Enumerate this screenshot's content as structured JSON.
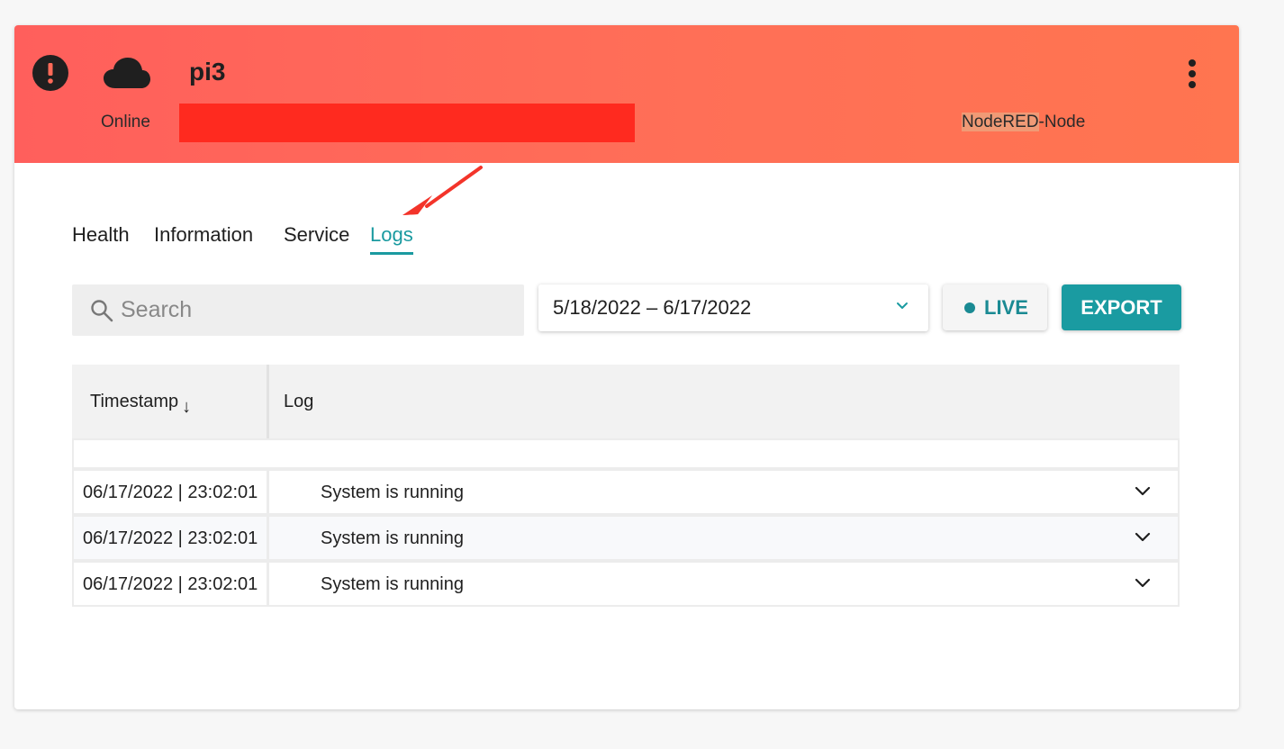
{
  "header": {
    "device_name": "pi3",
    "status": "Online",
    "node_type_highlight": "NodeRED",
    "node_type_rest": "-Node",
    "background_color": "#ff6a58",
    "redaction_color": "#ff2a1f"
  },
  "icons": {
    "alert": "alert-icon",
    "cloud": "cloud-icon",
    "menu": "more-vertical-icon",
    "search": "search-icon",
    "chevron": "chevron-down-icon"
  },
  "tabs": [
    {
      "label": "Health",
      "active": false
    },
    {
      "label": "Information",
      "active": false
    },
    {
      "label": "Service",
      "active": false
    },
    {
      "label": "Logs",
      "active": true
    }
  ],
  "search": {
    "placeholder": "Search",
    "value": ""
  },
  "date_range": {
    "value": "5/18/2022 – 6/17/2022"
  },
  "live_button": {
    "label": "LIVE"
  },
  "export_button": {
    "label": "EXPORT"
  },
  "accent_color": "#1a9ba1",
  "table": {
    "columns": [
      "Timestamp",
      "Log"
    ],
    "sort_indicator": "↓",
    "rows": [
      {
        "timestamp": "06/17/2022 | 23:02:01",
        "log": "System is running"
      },
      {
        "timestamp": "06/17/2022 | 23:02:01",
        "log": "System is running"
      },
      {
        "timestamp": "06/17/2022 | 23:02:01",
        "log": "System is running"
      }
    ]
  }
}
